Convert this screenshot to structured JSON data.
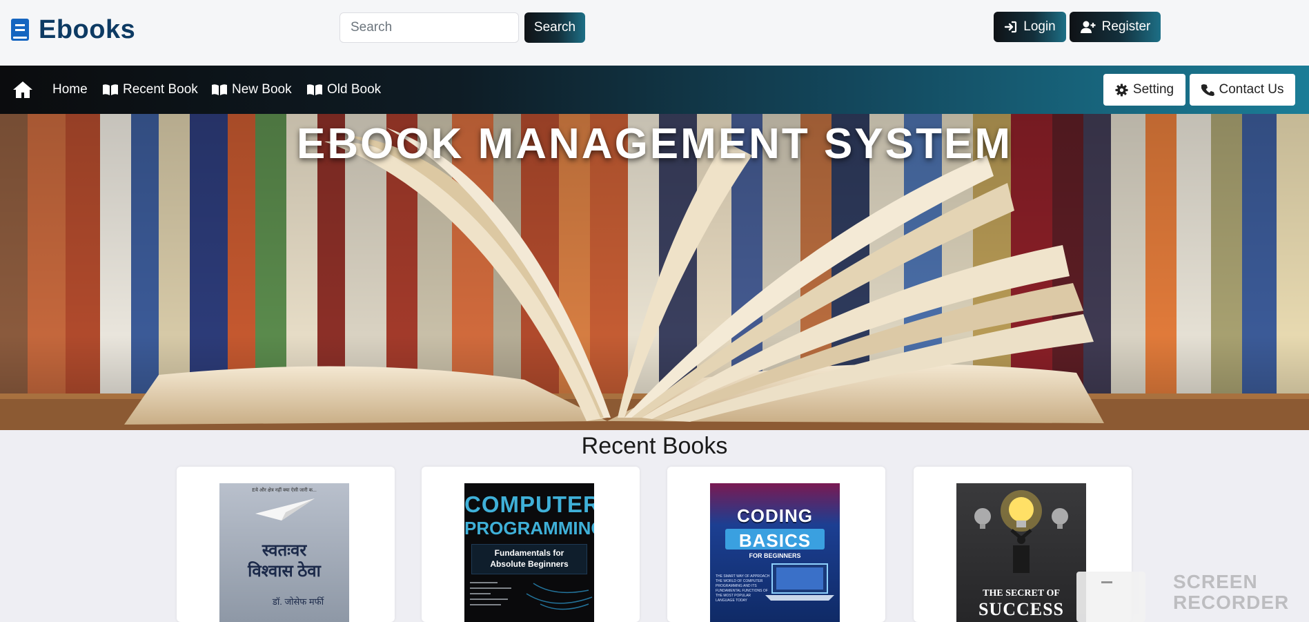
{
  "header": {
    "brand": "Ebooks",
    "search": {
      "placeholder": "Search",
      "button_label": "Search"
    },
    "login_label": "Login",
    "register_label": "Register"
  },
  "nav": {
    "items": [
      {
        "label": "Home"
      },
      {
        "label": "Recent Book"
      },
      {
        "label": "New Book"
      },
      {
        "label": "Old Book"
      }
    ],
    "setting_label": "Setting",
    "contact_label": "Contact Us",
    "colors": {
      "nav_start": "#0b0c0e",
      "nav_end": "#1b7d97"
    }
  },
  "hero": {
    "title": "EBOOK MANAGEMENT SYSTEM"
  },
  "recent": {
    "title": "Recent Books",
    "books": [
      {
        "top_line": "Eये और क्षेत्र नहीं क्या ऐसी जारी क...",
        "title_line1": "स्वतःवर",
        "title_line2": "विश्वास ठेवा",
        "author": "डॉ. जोसेफ मर्फी"
      },
      {
        "title_line1": "COMPUTER",
        "title_line2": "PROGRAMMING",
        "subtitle_line1": "Fundamentals for",
        "subtitle_line2": "Absolute Beginners"
      },
      {
        "title_line1": "CODING",
        "title_line2": "BASICS",
        "subtitle": "FOR BEGINNERS",
        "blurb": "THE SMART WAY OF APPROACH THE WORLD OF COMPUTER PROGRAMMING AND ITS FUNDAMENTAL FUNCTIONS OF THE MOST POPULAR LANGUAGE TODAY"
      },
      {
        "title_line1": "THE SECRET OF",
        "title_line2": "SUCCESS"
      }
    ]
  },
  "recorder": {
    "line1": "SCREEN",
    "line2": "RECORDER"
  }
}
